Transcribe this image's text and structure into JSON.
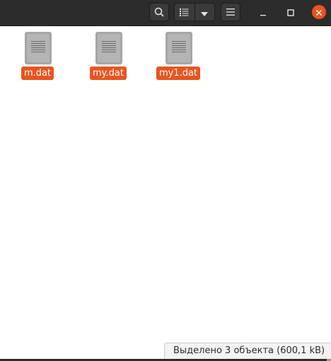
{
  "header": {
    "buttons": {
      "search": "search-icon",
      "view": "list-view-icon",
      "view_menu": "chevron-down-icon",
      "menu": "hamburger-menu-icon"
    },
    "window_controls": [
      "minimize-icon",
      "maximize-icon",
      "close-icon"
    ]
  },
  "files": [
    {
      "name": "m.dat",
      "icon": "text-file-icon",
      "selected": true
    },
    {
      "name": "my.dat",
      "icon": "text-file-icon",
      "selected": true
    },
    {
      "name": "my1.dat",
      "icon": "text-file-icon",
      "selected": true
    }
  ],
  "status": {
    "text": "Выделено 3 объекта  (600,1 kB)"
  },
  "colors": {
    "accent": "#e95420",
    "headerbar": "#2c2c2c"
  }
}
